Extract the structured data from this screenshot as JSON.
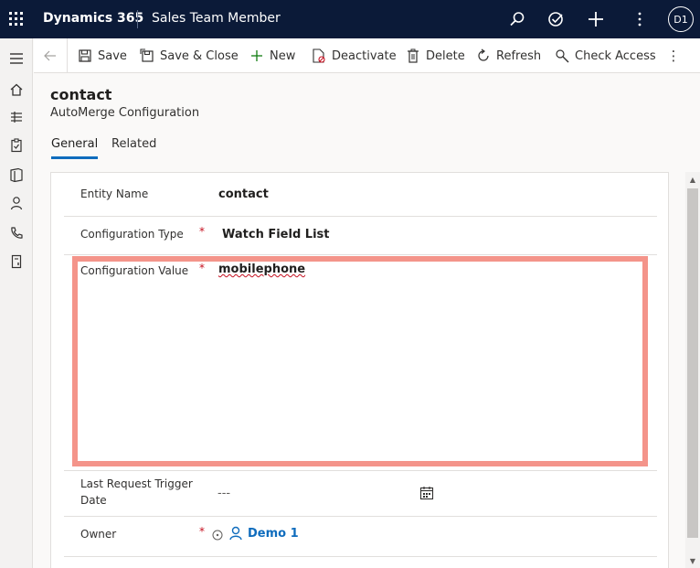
{
  "topbar": {
    "app_name": "Dynamics 365",
    "area_name": "Sales Team Member",
    "avatar_initials": "D1",
    "icons": [
      "search-icon",
      "task-icon",
      "add-icon",
      "more-icon"
    ]
  },
  "leftnav": {
    "icons": [
      "hamburger-icon",
      "home-icon",
      "pin-icon",
      "clipboard-icon",
      "book-icon",
      "person-icon",
      "phone-icon",
      "document-icon"
    ]
  },
  "commands": {
    "save": "Save",
    "save_close": "Save & Close",
    "new": "New",
    "deactivate": "Deactivate",
    "delete": "Delete",
    "refresh": "Refresh",
    "check_access": "Check Access",
    "more": "⋮"
  },
  "record": {
    "title": "contact",
    "subtitle": "AutoMerge Configuration"
  },
  "tabs": [
    {
      "label": "General",
      "active": true
    },
    {
      "label": "Related",
      "active": false
    }
  ],
  "form": {
    "entity_name": {
      "label": "Entity Name",
      "value": "contact"
    },
    "config_type": {
      "label": "Configuration Type",
      "required": "*",
      "value": "Watch Field List"
    },
    "config_value": {
      "label": "Configuration Value",
      "required": "*",
      "value": "mobilephone"
    },
    "last_request": {
      "label": "Last Request Trigger Date",
      "value": "---"
    },
    "owner": {
      "label": "Owner",
      "required": "*",
      "value": "Demo 1"
    }
  },
  "colors": {
    "topbar": "#0b1a38",
    "accent": "#0f6cbd",
    "required": "#c50f1f",
    "highlight": "#f4948a"
  }
}
